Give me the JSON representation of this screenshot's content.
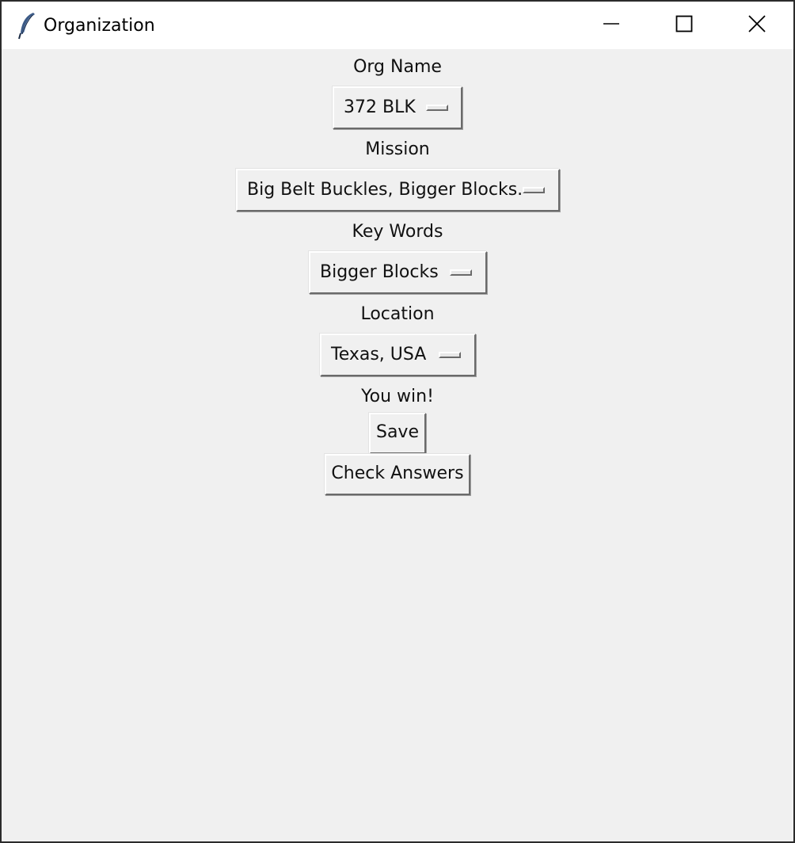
{
  "window": {
    "title": "Organization",
    "icon": "feather-icon",
    "controls": [
      "minimize-icon",
      "maximize-icon",
      "close-icon"
    ]
  },
  "form": {
    "org_name": {
      "label": "Org Name",
      "selected": "372 BLK"
    },
    "mission": {
      "label": "Mission",
      "selected": "Big Belt Buckles, Bigger Blocks."
    },
    "key_words": {
      "label": "Key Words",
      "selected": "Bigger Blocks"
    },
    "location": {
      "label": "Location",
      "selected": "Texas, USA"
    },
    "result_message": "You win!",
    "save_label": "Save",
    "check_answers_label": "Check Answers"
  },
  "colors": {
    "background": "#f0f0f0",
    "titlebar": "#ffffff",
    "text": "#111111",
    "border_dark": "#6a6a6a",
    "border_light": "#ffffff"
  }
}
